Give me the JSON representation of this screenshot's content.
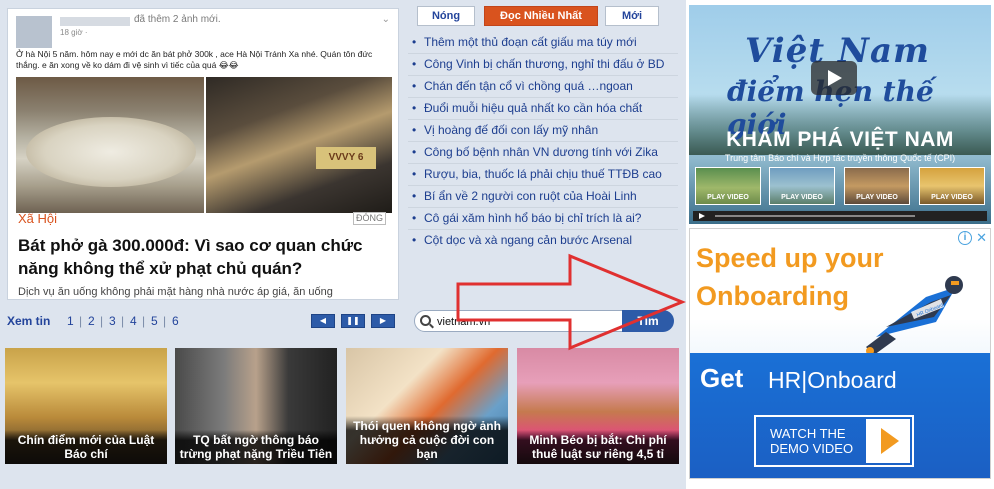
{
  "feature": {
    "fb_added": "đã thêm 2 ảnh mới.",
    "fb_time": "18 giờ ·",
    "fb_text": "Ở hà Nội 5 năm. hôm nay e mới dc ăn bát phở 300k , ace Hà Nội Tránh Xa nhé. Quán                       tôn đức thắng.  e ăn xong về ko dám đi vệ sinh vì tiếc của quá 😂😂",
    "photo_sign": "VVVY 6",
    "category": "Xã Hội",
    "dong_label": "ĐÓNG",
    "headline": "Bát phở gà 300.000đ: Vì sao cơ quan chức năng không thể xử phạt chủ quán?",
    "sapo": "Dịch vụ ăn uống không phải mặt hàng nhà nước áp giá, ăn uống"
  },
  "pager": {
    "label": "Xem tin",
    "pages": [
      "1",
      "2",
      "3",
      "4",
      "5",
      "6"
    ],
    "prev_icon": "◀",
    "pause_icon": "❚❚",
    "next_icon": "▶"
  },
  "tabs": [
    "Nóng",
    "Đọc Nhiều Nhất",
    "Mới"
  ],
  "news": [
    "Thêm một thủ đoạn cất giấu ma túy mới",
    "Công Vinh bị chấn thương, nghỉ thi đấu ở BD",
    "Chán đến tận cổ vì chồng quá …ngoan",
    "Đuổi muỗi hiệu quả nhất ko cần hóa chất",
    "Vị hoàng đế đối con lấy mỹ nhân",
    "Công bố bệnh nhân VN dương tính với Zika",
    "Rượu, bia, thuốc lá phải chịu thuế TTĐB cao",
    "Bí ẩn về 2 người con ruột của Hoài Linh",
    "Cô gái xăm hình hổ báo bị chỉ trích là ai?",
    "Cột dọc và xà ngang cản bước Arsenal"
  ],
  "search": {
    "value": "vietnam.vn",
    "button": "Tìm"
  },
  "cards": [
    {
      "caption": "Chín điểm mới của Luật Báo chí"
    },
    {
      "caption": "TQ bất ngờ thông báo trừng phạt nặng Triều Tiên"
    },
    {
      "caption": "Thói quen không ngờ ảnh hưởng cả cuộc đời con bạn"
    },
    {
      "caption": "Minh Béo bị bắt: Chi phí thuê luật sư riêng 4,5 tỉ"
    }
  ],
  "ad_vietnam": {
    "script_line1": "Việt Nam",
    "script_line2": "điểm hẹn thế giới",
    "title": "KHÁM PHÁ VIỆT NAM",
    "subtitle": "Trung tâm Báo chí và Hợp tác truyền thông Quốc tế (CPI)",
    "thumb_label": "PLAY VIDEO"
  },
  "ad_hr": {
    "adchoice": "i",
    "close": "✕",
    "headline_1": "Speed up your",
    "headline_2": "Onboarding",
    "hero_badge": "HR Onboard",
    "get": "Get",
    "brand": "HR|Onboard",
    "cta_1": "WATCH THE",
    "cta_2": "DEMO VIDEO",
    "colors": {
      "orange": "#f29a20",
      "blue": "#1a70d6"
    }
  },
  "colors": {
    "link_blue": "#1d3e8f",
    "accent_orange": "#d9531e",
    "arrow_red": "#e03030"
  }
}
